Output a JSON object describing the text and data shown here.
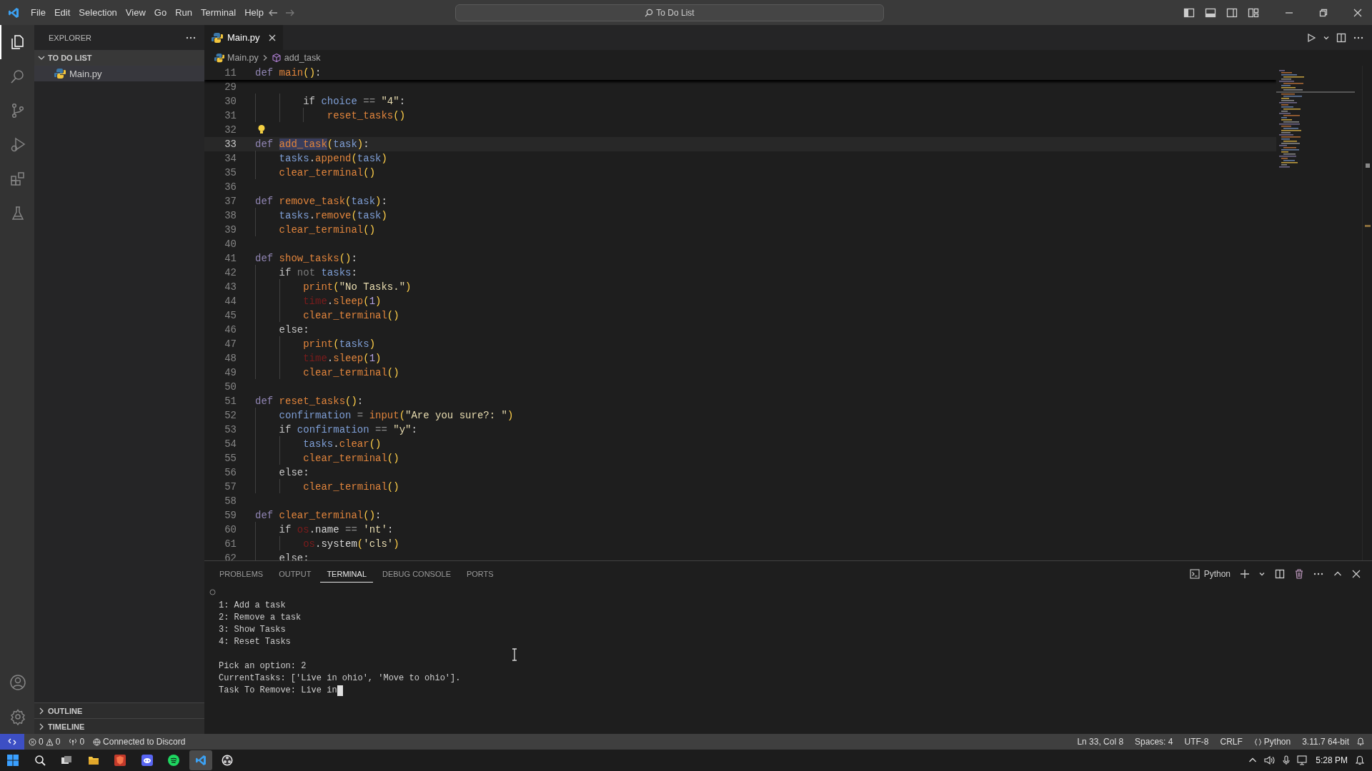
{
  "window": {
    "title": "To Do List",
    "menu": [
      "File",
      "Edit",
      "Selection",
      "View",
      "Go",
      "Run",
      "Terminal",
      "Help"
    ]
  },
  "activity_bar": {
    "items": [
      {
        "selected": true
      },
      {
        "selected": false
      },
      {
        "selected": false
      },
      {
        "selected": false
      },
      {
        "selected": false
      },
      {
        "selected": false
      }
    ]
  },
  "sidebar": {
    "title": "EXPLORER",
    "sections": [
      {
        "label": "TO DO LIST",
        "expanded": true,
        "files": [
          {
            "name": "Main.py",
            "selected": true
          }
        ]
      },
      {
        "label": "OUTLINE",
        "expanded": false
      },
      {
        "label": "TIMELINE",
        "expanded": false
      }
    ]
  },
  "editor": {
    "tabs": [
      {
        "label": "Main.py",
        "selected": true
      }
    ],
    "breadcrumb": [
      "Main.py",
      "add_task"
    ],
    "sticky_line": {
      "n": "11",
      "tokens": [
        {
          "kind": "kw",
          "text": "def"
        },
        {
          "kind": "fn",
          "text": " main"
        },
        {
          "kind": "p",
          "text": "()"
        },
        {
          "kind": "pl",
          "text": ":"
        }
      ]
    },
    "lines": [
      {
        "n": "29",
        "current": false
      },
      {
        "n": "30",
        "current": false,
        "tokens": [
          {
            "kind": "ctl",
            "text": "        if"
          },
          {
            "kind": "var",
            "text": " choice"
          },
          {
            "kind": "op",
            "text": " =="
          },
          {
            "kind": "str",
            "text": " \"4\""
          },
          {
            "kind": "pl",
            "text": ":"
          }
        ]
      },
      {
        "n": "31",
        "current": false,
        "tokens": [
          {
            "kind": "fn",
            "text": "            reset_tasks"
          },
          {
            "kind": "p",
            "text": "()"
          }
        ]
      },
      {
        "n": "32",
        "current": false,
        "lightbulb": true
      },
      {
        "n": "33",
        "current": true,
        "tokens": [
          {
            "kind": "kw",
            "text": "def "
          },
          {
            "kind": "fn",
            "text": "add_task",
            "highlight": true
          },
          {
            "kind": "p",
            "text": "("
          },
          {
            "kind": "var",
            "text": "task"
          },
          {
            "kind": "p",
            "text": ")"
          },
          {
            "kind": "pl",
            "text": ":"
          }
        ]
      },
      {
        "n": "34",
        "current": false,
        "tokens": [
          {
            "kind": "var",
            "text": "    tasks"
          },
          {
            "kind": "pl",
            "text": "."
          },
          {
            "kind": "fn",
            "text": "append"
          },
          {
            "kind": "p",
            "text": "("
          },
          {
            "kind": "var",
            "text": "task"
          },
          {
            "kind": "p",
            "text": ")"
          }
        ]
      },
      {
        "n": "35",
        "current": false,
        "tokens": [
          {
            "kind": "fn",
            "text": "    clear_terminal"
          },
          {
            "kind": "p",
            "text": "()"
          }
        ]
      },
      {
        "n": "36",
        "current": false
      },
      {
        "n": "37",
        "current": false,
        "tokens": [
          {
            "kind": "kw",
            "text": "def"
          },
          {
            "kind": "fn",
            "text": " remove_task"
          },
          {
            "kind": "p",
            "text": "("
          },
          {
            "kind": "var",
            "text": "task"
          },
          {
            "kind": "p",
            "text": ")"
          },
          {
            "kind": "pl",
            "text": ":"
          }
        ]
      },
      {
        "n": "38",
        "current": false,
        "tokens": [
          {
            "kind": "var",
            "text": "    tasks"
          },
          {
            "kind": "pl",
            "text": "."
          },
          {
            "kind": "fn",
            "text": "remove"
          },
          {
            "kind": "p",
            "text": "("
          },
          {
            "kind": "var",
            "text": "task"
          },
          {
            "kind": "p",
            "text": ")"
          }
        ]
      },
      {
        "n": "39",
        "current": false,
        "tokens": [
          {
            "kind": "fn",
            "text": "    clear_terminal"
          },
          {
            "kind": "p",
            "text": "()"
          }
        ]
      },
      {
        "n": "40",
        "current": false
      },
      {
        "n": "41",
        "current": false,
        "tokens": [
          {
            "kind": "kw",
            "text": "def"
          },
          {
            "kind": "fn",
            "text": " show_tasks"
          },
          {
            "kind": "p",
            "text": "()"
          },
          {
            "kind": "pl",
            "text": ":"
          }
        ]
      },
      {
        "n": "42",
        "current": false,
        "tokens": [
          {
            "kind": "ctl",
            "text": "    if"
          },
          {
            "kind": "dim",
            "text": " not"
          },
          {
            "kind": "var",
            "text": " tasks"
          },
          {
            "kind": "pl",
            "text": ":"
          }
        ]
      },
      {
        "n": "43",
        "current": false,
        "tokens": [
          {
            "kind": "fn",
            "text": "        print"
          },
          {
            "kind": "p",
            "text": "("
          },
          {
            "kind": "str",
            "text": "\"No Tasks.\""
          },
          {
            "kind": "p",
            "text": ")"
          }
        ]
      },
      {
        "n": "44",
        "current": false,
        "tokens": [
          {
            "kind": "err",
            "text": "        time"
          },
          {
            "kind": "pl",
            "text": "."
          },
          {
            "kind": "fn",
            "text": "sleep"
          },
          {
            "kind": "p",
            "text": "("
          },
          {
            "kind": "num",
            "text": "1"
          },
          {
            "kind": "p",
            "text": ")"
          }
        ]
      },
      {
        "n": "45",
        "current": false,
        "tokens": [
          {
            "kind": "fn",
            "text": "        clear_terminal"
          },
          {
            "kind": "p",
            "text": "()"
          }
        ]
      },
      {
        "n": "46",
        "current": false,
        "tokens": [
          {
            "kind": "ctl",
            "text": "    else"
          },
          {
            "kind": "pl",
            "text": ":"
          }
        ]
      },
      {
        "n": "47",
        "current": false,
        "tokens": [
          {
            "kind": "fn",
            "text": "        print"
          },
          {
            "kind": "p",
            "text": "("
          },
          {
            "kind": "var",
            "text": "tasks"
          },
          {
            "kind": "p",
            "text": ")"
          }
        ]
      },
      {
        "n": "48",
        "current": false,
        "tokens": [
          {
            "kind": "err",
            "text": "        time"
          },
          {
            "kind": "pl",
            "text": "."
          },
          {
            "kind": "fn",
            "text": "sleep"
          },
          {
            "kind": "p",
            "text": "("
          },
          {
            "kind": "num",
            "text": "1"
          },
          {
            "kind": "p",
            "text": ")"
          }
        ]
      },
      {
        "n": "49",
        "current": false,
        "tokens": [
          {
            "kind": "fn",
            "text": "        clear_terminal"
          },
          {
            "kind": "p",
            "text": "()"
          }
        ]
      },
      {
        "n": "50",
        "current": false
      },
      {
        "n": "51",
        "current": false,
        "tokens": [
          {
            "kind": "kw",
            "text": "def"
          },
          {
            "kind": "fn",
            "text": " reset_tasks"
          },
          {
            "kind": "p",
            "text": "()"
          },
          {
            "kind": "pl",
            "text": ":"
          }
        ]
      },
      {
        "n": "52",
        "current": false,
        "tokens": [
          {
            "kind": "var",
            "text": "    confirmation"
          },
          {
            "kind": "op",
            "text": " ="
          },
          {
            "kind": "fn",
            "text": " input"
          },
          {
            "kind": "p",
            "text": "("
          },
          {
            "kind": "str",
            "text": "\"Are you sure?: \""
          },
          {
            "kind": "p",
            "text": ")"
          }
        ]
      },
      {
        "n": "53",
        "current": false,
        "tokens": [
          {
            "kind": "ctl",
            "text": "    if"
          },
          {
            "kind": "var",
            "text": " confirmation"
          },
          {
            "kind": "op",
            "text": " =="
          },
          {
            "kind": "str",
            "text": " \"y\""
          },
          {
            "kind": "pl",
            "text": ":"
          }
        ]
      },
      {
        "n": "54",
        "current": false,
        "tokens": [
          {
            "kind": "var",
            "text": "        tasks"
          },
          {
            "kind": "pl",
            "text": "."
          },
          {
            "kind": "fn",
            "text": "clear"
          },
          {
            "kind": "p",
            "text": "()"
          }
        ]
      },
      {
        "n": "55",
        "current": false,
        "tokens": [
          {
            "kind": "fn",
            "text": "        clear_terminal"
          },
          {
            "kind": "p",
            "text": "()"
          }
        ]
      },
      {
        "n": "56",
        "current": false,
        "tokens": [
          {
            "kind": "ctl",
            "text": "    else"
          },
          {
            "kind": "pl",
            "text": ":"
          }
        ]
      },
      {
        "n": "57",
        "current": false,
        "tokens": [
          {
            "kind": "fn",
            "text": "        clear_terminal"
          },
          {
            "kind": "p",
            "text": "()"
          }
        ]
      },
      {
        "n": "58",
        "current": false
      },
      {
        "n": "59",
        "current": false,
        "tokens": [
          {
            "kind": "kw",
            "text": "def"
          },
          {
            "kind": "fn",
            "text": " clear_terminal"
          },
          {
            "kind": "p",
            "text": "()"
          },
          {
            "kind": "pl",
            "text": ":"
          }
        ]
      },
      {
        "n": "60",
        "current": false,
        "tokens": [
          {
            "kind": "ctl",
            "text": "    if"
          },
          {
            "kind": "err",
            "text": " os"
          },
          {
            "kind": "pl",
            "text": ".name"
          },
          {
            "kind": "op",
            "text": " =="
          },
          {
            "kind": "str",
            "text": " 'nt'"
          },
          {
            "kind": "pl",
            "text": ":"
          }
        ]
      },
      {
        "n": "61",
        "current": false,
        "tokens": [
          {
            "kind": "err",
            "text": "        os"
          },
          {
            "kind": "pl",
            "text": ".system"
          },
          {
            "kind": "p",
            "text": "("
          },
          {
            "kind": "str",
            "text": "'cls'"
          },
          {
            "kind": "p",
            "text": ")"
          }
        ]
      },
      {
        "n": "62",
        "current": false,
        "tokens": [
          {
            "kind": "ctl",
            "text": "    else"
          },
          {
            "kind": "pl",
            "text": ":"
          }
        ]
      }
    ]
  },
  "panel": {
    "tabs": [
      {
        "label": "PROBLEMS",
        "selected": false
      },
      {
        "label": "OUTPUT",
        "selected": false
      },
      {
        "label": "TERMINAL",
        "selected": true
      },
      {
        "label": "DEBUG CONSOLE",
        "selected": false
      },
      {
        "label": "PORTS",
        "selected": false
      }
    ],
    "terminal_name": "Python",
    "terminal_blocks": [
      [
        "1: Add a task",
        "2: Remove a task",
        "3: Show Tasks",
        "4: Reset Tasks"
      ],
      [
        "Pick an option: 2",
        "CurrentTasks: ['Live in ohio', 'Move to ohio'].",
        "Task To Remove: Live in"
      ]
    ],
    "cursor": true
  },
  "status_bar": {
    "errors": "0",
    "warnings": "0",
    "ports": "0",
    "discord": "Connected to Discord",
    "right": [
      "Ln 33, Col 8",
      "Spaces: 4",
      "UTF-8",
      "CRLF"
    ],
    "language": "Python",
    "interpreter": "3.11.7 64-bit"
  },
  "taskbar": {
    "apps": [
      {
        "selected": false
      },
      {
        "selected": false
      },
      {
        "selected": false
      },
      {
        "selected": false
      },
      {
        "selected": false
      },
      {
        "selected": true
      },
      {
        "selected": false
      }
    ],
    "time": "5:28 PM"
  }
}
